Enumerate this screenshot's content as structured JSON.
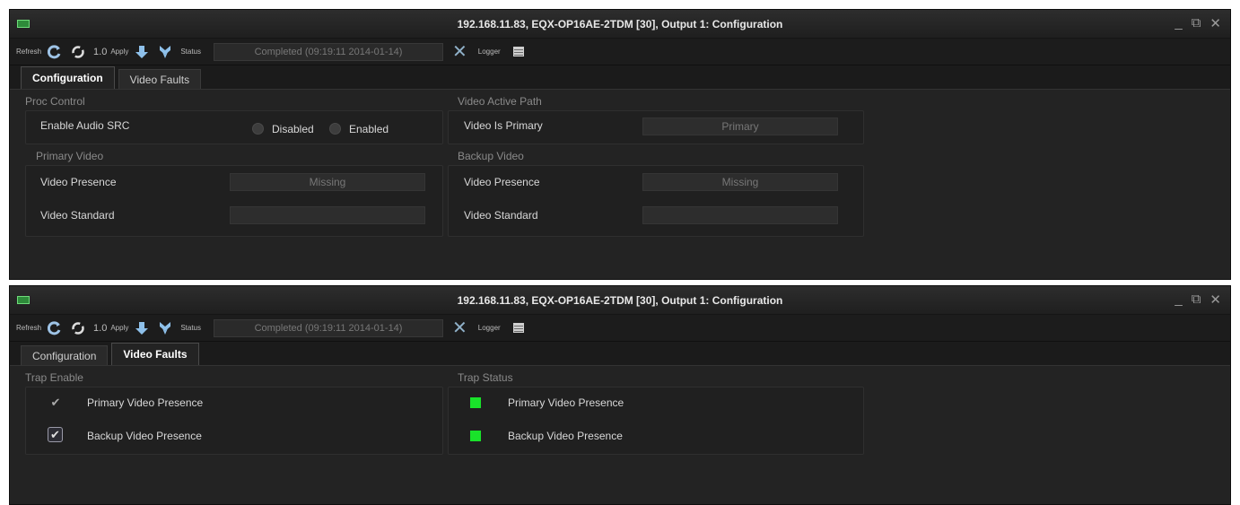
{
  "window1": {
    "title": "192.168.11.83, EQX-OP16AE-2TDM  [30], Output 1: Configuration",
    "toolbar": {
      "refresh_label": "Refresh",
      "rate_value": "1.0",
      "apply_label": "Apply",
      "status_label": "Status",
      "status_text": "Completed  (09:19:11  2014-01-14)",
      "logger_label": "Logger"
    },
    "tabs": [
      {
        "label": "Configuration",
        "active": true
      },
      {
        "label": "Video Faults",
        "active": false
      }
    ],
    "proc_control": {
      "title": "Proc Control",
      "enable_audio_src_label": "Enable Audio SRC",
      "option_disabled": "Disabled",
      "option_enabled": "Enabled"
    },
    "video_active_path": {
      "title": "Video Active Path",
      "video_is_primary_label": "Video Is Primary",
      "video_is_primary_value": "Primary"
    },
    "primary_video": {
      "title": "Primary Video",
      "presence_label": "Video Presence",
      "presence_value": "Missing",
      "standard_label": "Video Standard",
      "standard_value": ""
    },
    "backup_video": {
      "title": "Backup Video",
      "presence_label": "Video Presence",
      "presence_value": "Missing",
      "standard_label": "Video Standard",
      "standard_value": ""
    }
  },
  "window2": {
    "title": "192.168.11.83, EQX-OP16AE-2TDM  [30], Output 1: Configuration",
    "toolbar": {
      "refresh_label": "Refresh",
      "rate_value": "1.0",
      "apply_label": "Apply",
      "status_label": "Status",
      "status_text": "Completed  (09:19:11  2014-01-14)",
      "logger_label": "Logger"
    },
    "tabs": [
      {
        "label": "Configuration",
        "active": false
      },
      {
        "label": "Video Faults",
        "active": true
      }
    ],
    "trap_enable": {
      "title": "Trap Enable",
      "items": [
        {
          "label": "Primary Video Presence",
          "checked": true
        },
        {
          "label": "Backup Video Presence",
          "checked": true
        }
      ]
    },
    "trap_status": {
      "title": "Trap Status",
      "items": [
        {
          "label": "Primary Video Presence",
          "color": "#19e22a"
        },
        {
          "label": "Backup Video Presence",
          "color": "#19e22a"
        }
      ]
    }
  }
}
